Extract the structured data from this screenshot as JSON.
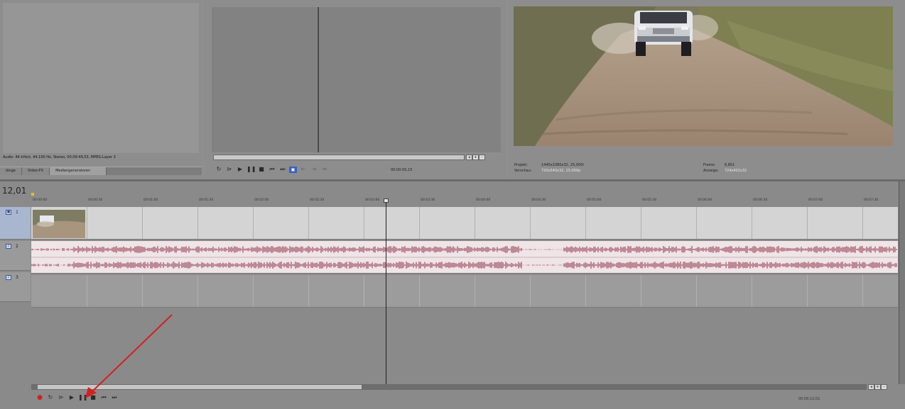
{
  "left_panel": {
    "info_text": "Audio: 44 kHz/s, 44.100 Hz, Stereo, 00:09:49,53, MPEG-Layer 3",
    "tabs": [
      {
        "label": "länge"
      },
      {
        "label": "Video-FX"
      },
      {
        "label": "Mediengeneratoren"
      }
    ]
  },
  "trimmer": {
    "timecode": "00:00:00,15",
    "controls": [
      "loop",
      "play-from-start",
      "play",
      "pause",
      "stop",
      "prev",
      "next"
    ]
  },
  "preview": {
    "projekt_label": "Projekt:",
    "projekt_value": "1440x1080x32, 25,000i",
    "vorschau_label": "Vorschau:",
    "vorschau_value": "720x540x32, 25,000p",
    "frame_label": "Frame:",
    "frame_value": "6,801",
    "anzeige_label": "Anzeige:",
    "anzeige_value": "724x402x32"
  },
  "timeline": {
    "cursor_time": "12,01",
    "ruler": [
      "00:00:00",
      "00:00:30",
      "00:01:00",
      "00:01:30",
      "00:02:00",
      "00:02:30",
      "00:03:00",
      "00:03:30",
      "00:04:00",
      "00:04:30",
      "00:05:00",
      "00:05:30",
      "00:06:00",
      "00:06:30",
      "00:07:00",
      "00:07:30"
    ],
    "end_timecode": "00:00:12,01"
  },
  "colors": {
    "waveform": "#8b2e44",
    "annotation_arrow": "#d42020",
    "record": "#cc2222"
  }
}
